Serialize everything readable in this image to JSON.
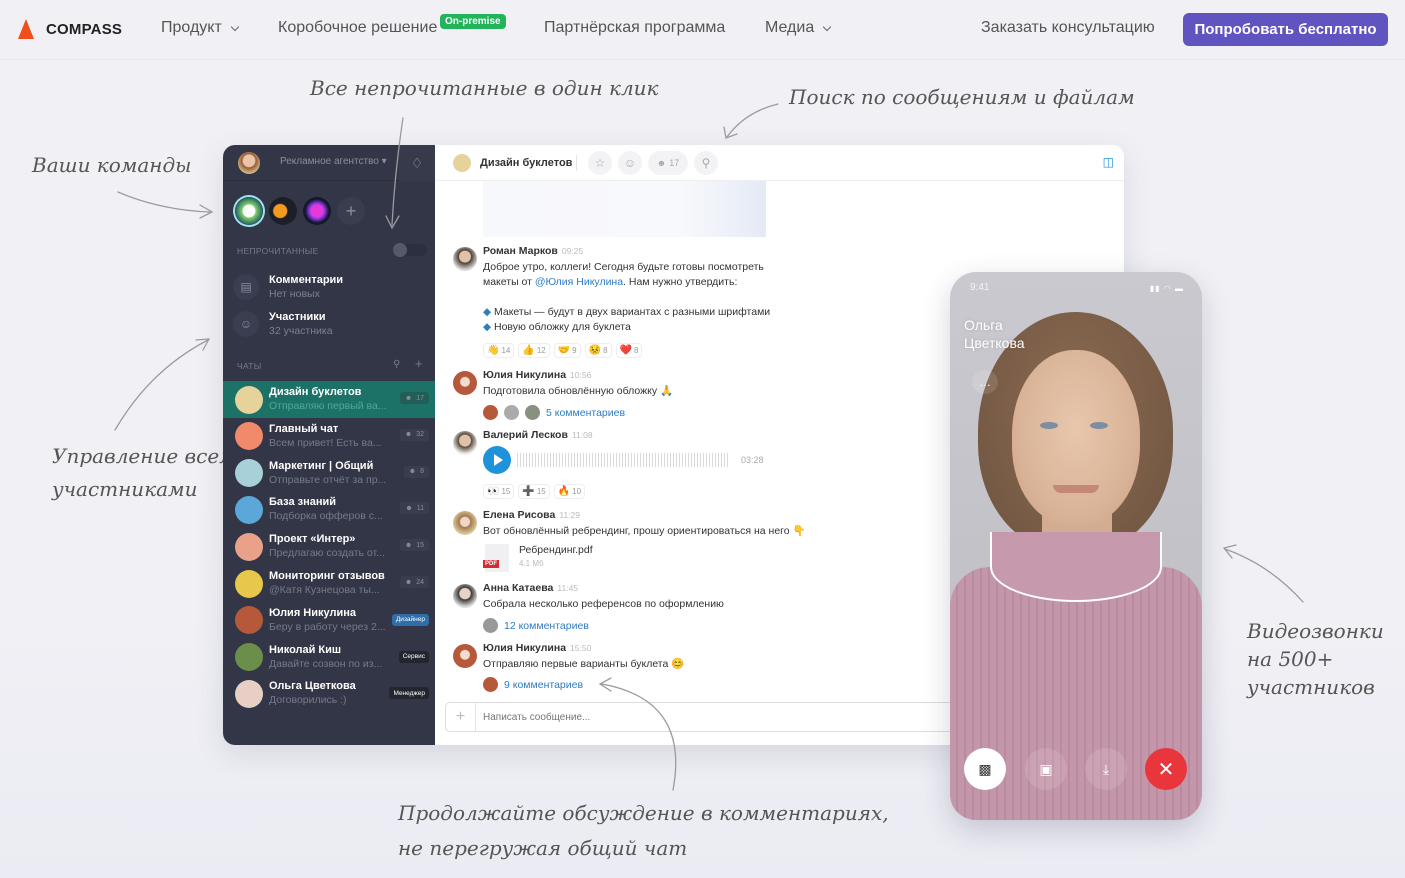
{
  "nav": {
    "brand": "COMPASS",
    "items": [
      {
        "label": "Продукт",
        "dropdown": true
      },
      {
        "label": "Коробочное решение",
        "badge": "On-premise"
      },
      {
        "label": "Партнёрская программа"
      },
      {
        "label": "Медиа",
        "dropdown": true
      }
    ],
    "consult_link": "Заказать консультацию",
    "cta_button": "Попробовать бесплатно",
    "colors": {
      "brand_orange": "#f04e1c",
      "cta": "#5f54c0",
      "badge_green": "#21b45a"
    }
  },
  "annotations": {
    "unread": "Все непрочитанные в один клик",
    "search": "Поиск по сообщениям и файлам",
    "teams": "Ваши команды",
    "members_line1": "Управление всеми",
    "members_line2": "участниками",
    "video_line1": "Видеозвонки",
    "video_line2": "на 500+",
    "video_line3": "участников",
    "comments_line1": "Продолжайте обсуждение в комментариях,",
    "comments_line2": "не перегружая общий чат"
  },
  "sidebar": {
    "org": "Рекламное агентство ▾",
    "unread_label": "НЕПРОЧИТАННЫЕ",
    "unread_toggle": false,
    "special": [
      {
        "title": "Комментарии",
        "subtitle": "Нет новых",
        "icon": "comment-icon"
      },
      {
        "title": "Участники",
        "subtitle": "32 участника",
        "icon": "users-icon"
      }
    ],
    "chats_label": "ЧАТЫ",
    "chats": [
      {
        "title": "Дизайн буклетов",
        "preview": "Отправляю первый ва...",
        "members": "17",
        "active": true,
        "avatar_color": "#e6d39c"
      },
      {
        "title": "Главный чат",
        "preview": "Всем привет! Есть ва...",
        "members": "32",
        "avatar_color": "#f08a6a"
      },
      {
        "title": "Маркетинг | Общий",
        "preview": "Отправьте отчёт за пр...",
        "members": "8",
        "avatar_color": "#a8d0d8"
      },
      {
        "title": "База знаний",
        "preview": "Подборка офферов с...",
        "members": "11",
        "avatar_color": "#5aa7d8"
      },
      {
        "title": "Проект «Интер»",
        "preview": "Предлагаю создать от...",
        "members": "15",
        "avatar_color": "#e9a189"
      },
      {
        "title": "Мониторинг отзывов",
        "preview": "@Катя Кузнецова ты...",
        "members": "24",
        "avatar_color": "#e8c84a"
      },
      {
        "title": "Юлия Никулина",
        "preview": "Беру в работу через 2...",
        "role": "Дизайнер",
        "role_color": "#2f6ea8",
        "avatar_color": "#b5593a"
      },
      {
        "title": "Николай Киш",
        "preview": "Давайте созвон по из...",
        "role": "Сервис",
        "role_color": "#23252f",
        "avatar_color": "#6b8f4a"
      },
      {
        "title": "Ольга Цветкова",
        "preview": "Договорились :)",
        "role": "Менеджер",
        "role_color": "#23252f",
        "avatar_color": "#e8cfc6"
      }
    ]
  },
  "chat": {
    "title": "Дизайн буклетов",
    "members": "17",
    "messages": [
      {
        "author": "Роман Марков",
        "time": "09:25",
        "line1_pre": "Доброе утро, коллеги! Сегодня будьте готовы посмотреть",
        "line2_pre": "макеты от ",
        "mention": "@Юлия Никулина",
        "line2_post": ". Нам нужно утвердить:",
        "bullet1": "Макеты — будут в двух вариантах с разными шрифтами",
        "bullet2": "Новую обложку для буклета",
        "reactions": [
          {
            "emoji": "👋",
            "count": "14"
          },
          {
            "emoji": "👍",
            "count": "12"
          },
          {
            "emoji": "🤝",
            "count": "9"
          },
          {
            "emoji": "😣",
            "count": "8"
          },
          {
            "emoji": "❤️",
            "count": "8"
          }
        ]
      },
      {
        "author": "Юлия Никулина",
        "time": "10:56",
        "text": "Подготовила обновлённую обложку 🙏",
        "comments": "5 комментариев"
      },
      {
        "author": "Валерий Лесков",
        "time": "11:08",
        "voice_duration": "03:28",
        "reactions": [
          {
            "emoji": "👀",
            "count": "15"
          },
          {
            "emoji": "➕",
            "count": "15"
          },
          {
            "emoji": "🔥",
            "count": "10"
          }
        ]
      },
      {
        "author": "Елена Рисова",
        "time": "11:29",
        "text": "Вот обновлённый ребрендинг, прошу ориентироваться на него 👇",
        "file_name": "Ребрендинг.pdf",
        "file_size": "4.1 Мб",
        "file_type": "PDF"
      },
      {
        "author": "Анна Катаева",
        "time": "11:45",
        "text": "Собрала несколько референсов по оформлению",
        "comments": "12 комментариев"
      },
      {
        "author": "Юлия Никулина",
        "time": "15:50",
        "text": "Отправляю первые варианты буклета 😊",
        "comments": "9 комментариев"
      }
    ],
    "input_placeholder": "Написать сообщение..."
  },
  "call": {
    "time": "9:41",
    "name_line1": "Ольга",
    "name_line2": "Цветкова",
    "controls": [
      "camera-toggle",
      "flip-camera",
      "mute-microphone",
      "end-call"
    ],
    "end_color": "#e8363c"
  }
}
